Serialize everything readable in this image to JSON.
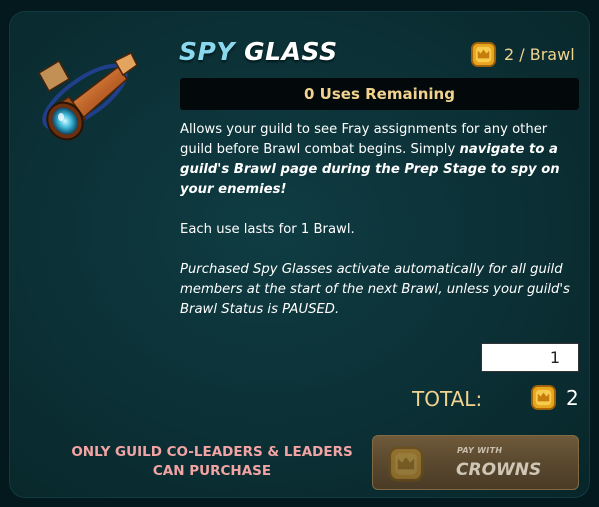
{
  "item": {
    "title_word1": "SPY",
    "title_word2": "GLASS",
    "cost_text": "2 / Brawl",
    "uses_remaining": "0 Uses Remaining",
    "art_icon": "spyglass-icon"
  },
  "description": {
    "p1_plain": "Allows your guild to see Fray assignments for any other guild before Brawl combat begins. Simply ",
    "p1_emphasis": "navigate to a guild's Brawl page during the Prep Stage to spy on your enemies!",
    "p2": "Each use lasts for 1 Brawl.",
    "p3": "Purchased Spy Glasses activate automatically for all guild members at the start of the next Brawl, unless your guild's Brawl Status is PAUSED."
  },
  "purchase": {
    "quantity": "1",
    "total_label": "TOTAL:",
    "total_amount": "2",
    "restriction_line1": "ONLY GUILD CO-LEADERS & LEADERS",
    "restriction_line2": "CAN PURCHASE",
    "pay_with_label": "PAY WITH",
    "currency_label": "CROWNS",
    "currency_icon": "crown-coin-icon"
  },
  "colors": {
    "accent_gold": "#f1d38f",
    "title_blue": "#8ad8ee",
    "warning_pink": "#f3a4a4",
    "panel_bg": "#0b3035"
  }
}
